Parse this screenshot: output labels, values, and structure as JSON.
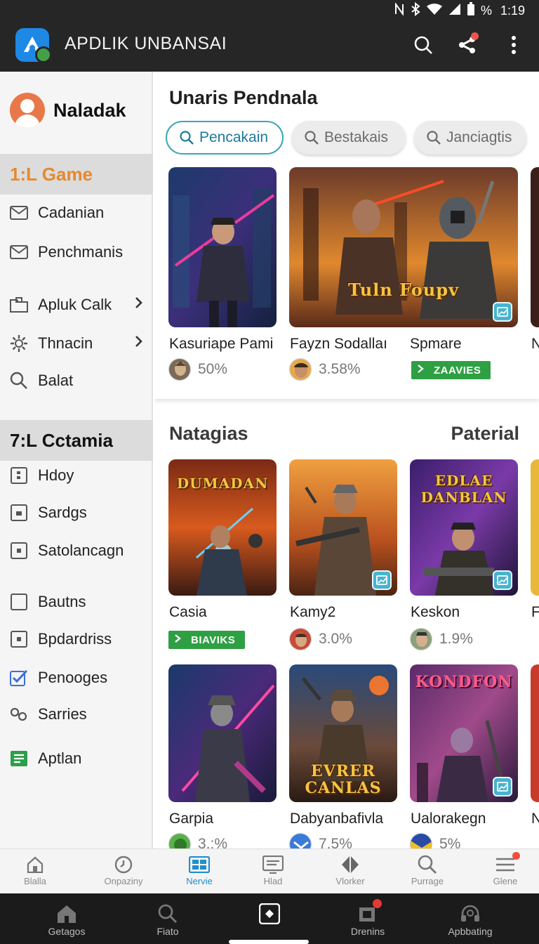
{
  "status_bar": {
    "time": "1:19",
    "battery_text": "%"
  },
  "app_bar": {
    "title": "APDLIK UNBANSAI"
  },
  "sidebar": {
    "profile_name": "Naladak",
    "section1_header": "1:L Game",
    "section1_items": [
      {
        "label": "Cadanian",
        "icon": "mail-icon"
      },
      {
        "label": "Penchmanis",
        "icon": "mail-icon"
      },
      {
        "label": "Apluk Calk",
        "icon": "folder-icon",
        "chevron": true
      },
      {
        "label": "Thnacin",
        "icon": "gear-icon",
        "chevron": true
      },
      {
        "label": "Balat",
        "icon": "search-icon"
      }
    ],
    "section2_header": "7:L Cctamia",
    "section2_items": [
      {
        "label": "Hdoy",
        "icon": "box-icon"
      },
      {
        "label": "Sardgs",
        "icon": "box-icon"
      },
      {
        "label": "Satolancagn",
        "icon": "box-icon"
      },
      {
        "label": "Bautns",
        "icon": "checkbox-icon"
      },
      {
        "label": "Bpdardriss",
        "icon": "box-icon"
      },
      {
        "label": "Penooges",
        "icon": "checked-box-icon"
      },
      {
        "label": "Sarries",
        "icon": "link-icon"
      },
      {
        "label": "Aptlan",
        "icon": "list-icon"
      }
    ]
  },
  "main": {
    "title": "Unaris Pendnala",
    "chips": [
      "Pencakain",
      "Bestakais",
      "Janciagtis"
    ],
    "featured": [
      {
        "title": "Kasuriape Pami",
        "rating": "50%"
      },
      {
        "title": "Fayzn Sodallaı",
        "rating": "3.58%",
        "art_text": "Tuln Foupv"
      },
      {
        "title": "Spmare",
        "tag": "ZAAVIES"
      },
      {
        "title": "N"
      }
    ],
    "section2_title": "Natagias",
    "section2_link": "Paterial",
    "grid_row1": [
      {
        "title": "Casia",
        "tag": "BIAVIKS",
        "art_text": "DUMADAN"
      },
      {
        "title": "Kamy2",
        "rating": "3.0%"
      },
      {
        "title": "Keskon",
        "rating": "1.9%",
        "art_text": "EDLAE DANBLAN"
      },
      {
        "title": "F"
      }
    ],
    "grid_row2": [
      {
        "title": "Garpia",
        "rating": "3.:%"
      },
      {
        "title": "Dabyanbafivla",
        "rating": "7.5%",
        "art_text": "EVRER CANLAS"
      },
      {
        "title": "Ualorakegn",
        "rating": "5%",
        "art_text": "KONDFON"
      },
      {
        "title": "N"
      }
    ]
  },
  "tab_bar": [
    {
      "label": "Blalla",
      "icon": "home-icon"
    },
    {
      "label": "Onpaziny",
      "icon": "clock-icon"
    },
    {
      "label": "Nervie",
      "icon": "grid-icon",
      "active": true
    },
    {
      "label": "Hlad",
      "icon": "monitor-icon"
    },
    {
      "label": "Vlorker",
      "icon": "diamond-icon"
    },
    {
      "label": "Purrage",
      "icon": "search-icon"
    },
    {
      "label": "Glene",
      "icon": "menu-icon",
      "notification": true
    }
  ],
  "system_nav": [
    {
      "label": "Getagos",
      "icon": "home-icon"
    },
    {
      "label": "Fiato",
      "icon": "search-icon"
    },
    {
      "label": "",
      "icon": "square-button-icon"
    },
    {
      "label": "Drenins",
      "icon": "folder-icon",
      "notification": true
    },
    {
      "label": "Apbbating",
      "icon": "headset-icon"
    }
  ],
  "colors": {
    "appbar": "#262626",
    "accent": "#1d8fcf",
    "orange_header": "#e6892e",
    "tag_green": "#2ea043",
    "notification_red": "#f04e3e"
  }
}
